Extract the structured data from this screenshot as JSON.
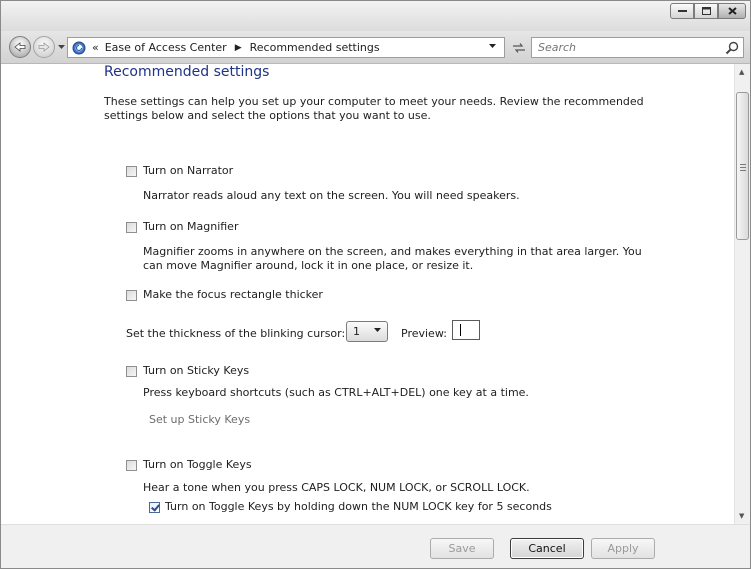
{
  "address": {
    "chevron": "«",
    "segments": [
      "Ease of Access Center",
      "Recommended settings"
    ]
  },
  "search": {
    "placeholder": "Search"
  },
  "content": {
    "title": "Recommended settings",
    "intro": "These settings can help you set up your computer to meet your needs. Review the recommended settings below and select the options that you want to use.",
    "narrator": {
      "label": "Turn on Narrator",
      "checked": false,
      "desc": "Narrator reads aloud any text on the screen. You will need speakers."
    },
    "magnifier": {
      "label": "Turn on Magnifier",
      "checked": false,
      "desc": "Magnifier zooms in anywhere on the screen, and makes everything in that area larger. You can move Magnifier around, lock it in one place, or resize it."
    },
    "focus": {
      "label": "Make the focus rectangle thicker",
      "checked": false
    },
    "cursor": {
      "label": "Set the thickness of the blinking cursor:",
      "value": "1",
      "preview_label": "Preview:"
    },
    "sticky": {
      "label": "Turn on Sticky Keys",
      "checked": false,
      "desc": "Press keyboard shortcuts (such as CTRL+ALT+DEL) one key at a time.",
      "link": "Set up Sticky Keys"
    },
    "toggle": {
      "label": "Turn on Toggle Keys",
      "checked": false,
      "desc": "Hear a tone when you press CAPS LOCK, NUM LOCK, or SCROLL LOCK.",
      "sub_label": "Turn on Toggle Keys by holding down the NUM LOCK key for 5 seconds",
      "sub_checked": true
    }
  },
  "buttons": {
    "save": "Save",
    "cancel": "Cancel",
    "apply": "Apply"
  },
  "icons": [
    "minimize-icon",
    "maximize-icon",
    "close-icon",
    "back-arrow-icon",
    "forward-arrow-icon",
    "ease-of-access-icon",
    "refresh-icon",
    "search-icon"
  ]
}
